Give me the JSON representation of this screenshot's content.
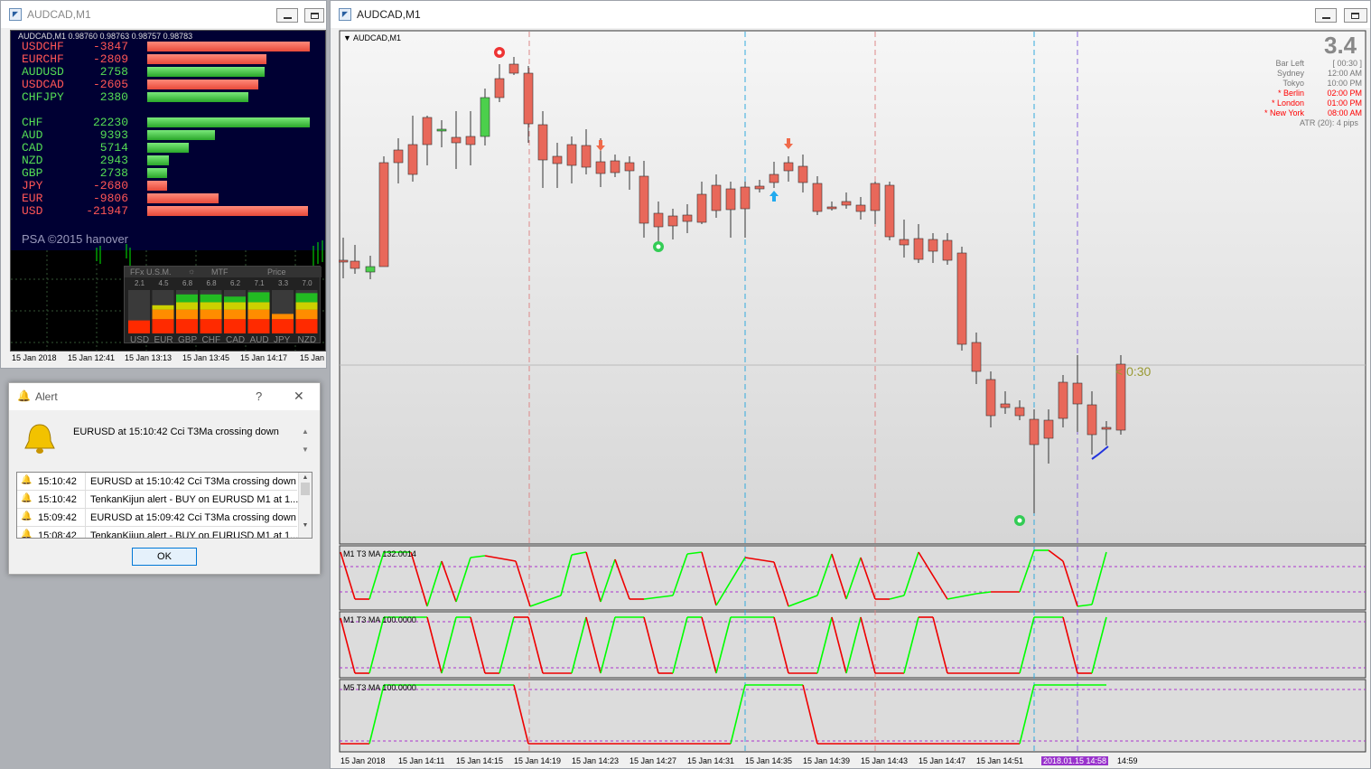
{
  "left_window": {
    "title": "AUDCAD,M1",
    "header_text": "AUDCAD,M1  0.98760 0.98763 0.98757 0.98783",
    "strength_rows": [
      {
        "pair": "USDCHF",
        "value": "-3847",
        "color": "#ff5555",
        "bar": 0.82
      },
      {
        "pair": "EURCHF",
        "value": "-2809",
        "color": "#ff5555",
        "bar": 0.6
      },
      {
        "pair": "AUDUSD",
        "value": "2758",
        "color": "#55dd55",
        "bar": 0.59
      },
      {
        "pair": "USDCAD",
        "value": "-2605",
        "color": "#ff5555",
        "bar": 0.56
      },
      {
        "pair": "CHFJPY",
        "value": "2380",
        "color": "#55dd55",
        "bar": 0.51
      }
    ],
    "currency_rows": [
      {
        "pair": "CHF",
        "value": "22230",
        "color": "#55dd55",
        "bar": 0.82
      },
      {
        "pair": "AUD",
        "value": "9393",
        "color": "#55dd55",
        "bar": 0.34
      },
      {
        "pair": "CAD",
        "value": "5714",
        "color": "#55dd55",
        "bar": 0.21
      },
      {
        "pair": "NZD",
        "value": "2943",
        "color": "#55dd55",
        "bar": 0.11
      },
      {
        "pair": "GBP",
        "value": "2738",
        "color": "#55dd55",
        "bar": 0.1
      },
      {
        "pair": "JPY",
        "value": "-2680",
        "color": "#ff5555",
        "bar": 0.1
      },
      {
        "pair": "EUR",
        "value": "-9806",
        "color": "#ff5555",
        "bar": 0.36
      },
      {
        "pair": "USD",
        "value": "-21947",
        "color": "#ff5555",
        "bar": 0.81
      }
    ],
    "copyright": "PSA ©2015 hanover",
    "usm_header": {
      "a": "FFx U.S.M.",
      "b": "MTF",
      "c": "Price"
    },
    "usm_values": [
      "2.1",
      "4.5",
      "6.8",
      "6.8",
      "6.2",
      "7.1",
      "3.3",
      "7.0"
    ],
    "usm_currencies": [
      "USD",
      "EUR",
      "GBP",
      "CHF",
      "CAD",
      "AUD",
      "JPY",
      "NZD"
    ],
    "usm_levels": [
      0.3,
      0.65,
      0.9,
      0.9,
      0.85,
      0.95,
      0.45,
      0.93
    ],
    "time_labels": [
      "15 Jan 2018",
      "15 Jan 12:41",
      "15 Jan 13:13",
      "15 Jan 13:45",
      "15 Jan 14:17",
      "15 Jan"
    ]
  },
  "alert": {
    "title": "Alert",
    "help": "?",
    "close": "✕",
    "message": "EURUSD at 15:10:42 Cci T3Ma crossing down",
    "rows": [
      {
        "time": "15:10:42",
        "text": "EURUSD at 15:10:42 Cci T3Ma crossing down"
      },
      {
        "time": "15:10:42",
        "text": "TenkanKijun alert - BUY on EURUSD M1 at 1..."
      },
      {
        "time": "15:09:42",
        "text": "EURUSD at 15:09:42 Cci T3Ma crossing down"
      },
      {
        "time": "15:08:42",
        "text": "TenkanKijun alert - BUY on EURUSD M1 at 1..."
      }
    ],
    "ok": "OK"
  },
  "main_window": {
    "title": "AUDCAD,M1",
    "chart_label": "AUDCAD,M1",
    "atr_big": "3.4",
    "info_rows": [
      {
        "label": "Bar Left",
        "value": "[ 00:30 ]",
        "color": "#777777"
      },
      {
        "label": "Sydney",
        "value": "12:00 AM",
        "color": "#777777"
      },
      {
        "label": "Tokyo",
        "value": "10:00 PM",
        "color": "#777777"
      },
      {
        "label": "* Berlin",
        "value": "02:00 PM",
        "color": "#ff0000"
      },
      {
        "label": "* London",
        "value": "01:00 PM",
        "color": "#ff0000"
      },
      {
        "label": "* New York",
        "value": "08:00 AM",
        "color": "#ff0000"
      }
    ],
    "atr_line": "ATR (20): 4 pips",
    "countdown": "< 0:30",
    "sub1_label": "M1  T3 MA  132.0014",
    "sub2_label": "M1  T3 MA  100.0000",
    "sub3_label": "M5  T3 MA  100.0000",
    "time_axis": [
      "15 Jan 2018",
      "15 Jan 14:11",
      "15 Jan 14:15",
      "15 Jan 14:19",
      "15 Jan 14:23",
      "15 Jan 14:27",
      "15 Jan 14:31",
      "15 Jan 14:35",
      "15 Jan 14:39",
      "15 Jan 14:43",
      "15 Jan 14:47",
      "15 Jan 14:51",
      "2018.01.15 14:58",
      "14:59"
    ]
  },
  "colors": {
    "bull": "#4cd04c",
    "bear": "#e8685a",
    "up": "#00ff00",
    "down": "#ee0000"
  }
}
